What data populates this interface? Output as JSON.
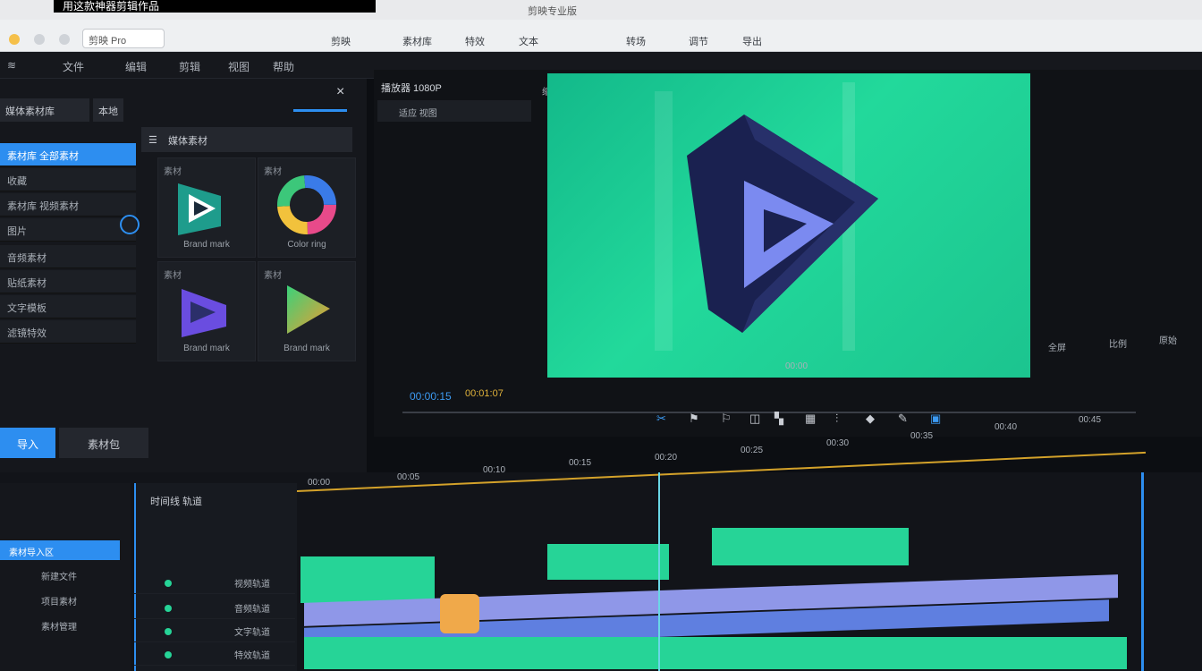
{
  "caption": "用这款神器剪辑作品",
  "window": {
    "title": "剪映专业版"
  },
  "browser": {
    "address": "剪映 Pro",
    "toolbar_items": [
      "剪映",
      "素材库",
      "特效",
      "文本",
      "转场",
      "调节",
      "导出"
    ]
  },
  "menubar": {
    "items": [
      "文件",
      "编辑",
      "剪辑",
      "视图",
      "帮助"
    ]
  },
  "left_panel": {
    "tabs": [
      "媒体素材库",
      "本地"
    ],
    "close": "×",
    "list": [
      {
        "label": "素材库 全部素材",
        "selected": true
      },
      {
        "label": "收藏"
      },
      {
        "label": "素材库 视频素材"
      },
      {
        "label": "图片"
      },
      {
        "label": "音频素材"
      },
      {
        "label": "贴纸素材"
      },
      {
        "label": "文字模板"
      },
      {
        "label": "滤镜特效"
      }
    ],
    "grid_header": "媒体素材",
    "assets": [
      {
        "tag": "素材",
        "caption": "Brand mark"
      },
      {
        "tag": "素材",
        "caption": "Color ring"
      },
      {
        "tag": "素材",
        "caption": "Brand mark"
      },
      {
        "tag": "素材",
        "caption": "Brand mark"
      }
    ],
    "primary_button": "导入",
    "secondary_button": "素材包"
  },
  "viewer": {
    "title": "播放器 1080P",
    "sub": "适应 视图",
    "zoom_label": "缩放",
    "timecode_left": "00:00:15",
    "timecode_right": "00:01:07",
    "ruler_label": "00:00",
    "corner_labels": [
      "全屏",
      "比例",
      "原始"
    ]
  },
  "timeline": {
    "header": "时间线 轨道",
    "ruler_labels": [
      "00:00",
      "00:05",
      "00:10",
      "00:15",
      "00:20",
      "00:25",
      "00:30",
      "00:35",
      "00:40",
      "00:45"
    ],
    "tracks": [
      "视频轨道",
      "音频轨道",
      "文字轨道",
      "特效轨道"
    ],
    "left_items": [
      "素材导入区",
      "新建文件",
      "项目素材",
      "素材管理"
    ]
  },
  "colors": {
    "accent": "#2d8ef0",
    "green": "#26d497",
    "lavender": "#8f97e8",
    "playhead": "#6ad6e6",
    "ruler": "#d4a22a"
  }
}
